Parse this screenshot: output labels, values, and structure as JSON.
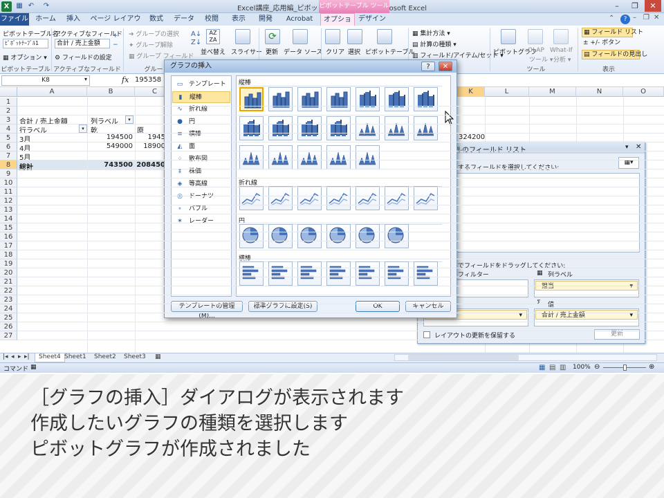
{
  "window": {
    "title": "Excel講座_応用編_ピボットテーブル.xlsx - Microsoft Excel",
    "qat_items": [
      "save-icon",
      "undo-icon",
      "redo-icon"
    ],
    "contextual_tab": "ピボットテーブル ツール"
  },
  "tabs": {
    "file": "ファイル",
    "home": "ホーム",
    "insert": "挿入",
    "page_layout": "ページ レイアウト",
    "formulas": "数式",
    "data": "データ",
    "review": "校閲",
    "view": "表示",
    "developer": "開発",
    "acrobat": "Acrobat",
    "options": "オプション",
    "design": "デザイン"
  },
  "ribbon": {
    "pivottable_name_label": "ピボットテーブル名:",
    "pivottable_name_value": "ﾋﾟﾎﾞｯﾄﾃｰﾌﾞﾙ1",
    "options_label": "オプション",
    "group_pivottable": "ピボットテーブル",
    "active_field_label": "アクティブなフィールド:",
    "active_field_value": "合計 / 売上金額",
    "field_settings": "フィールドの設定",
    "group_active_field": "アクティブなフィールド",
    "group_selection": "グループの選択",
    "ungroup": "グループ解除",
    "group_field": "グループ フィールド",
    "group_group": "グルー",
    "sort_label": "並べ替え",
    "slicer": "スライサー",
    "refresh": "更新",
    "data_source": "データ ソース",
    "clear": "クリア",
    "select": "選択",
    "move_pivottable": "ピボットテーブル",
    "summarize_by": "集計方法",
    "calc_type": "計算の種類",
    "fields_items_sets": "フィールド/アイテム/セット",
    "pivot_chart": "ピボットグラフ",
    "olap_tools": "OLAP",
    "olap_tools_2": "ツール",
    "what_if": "What-If",
    "what_if_2": "分析",
    "group_tools": "ツール",
    "field_list": "フィールド リスト",
    "buttons": "+/- ボタン",
    "field_headers": "フィールドの見出し",
    "group_show": "表示"
  },
  "formula_bar": {
    "name_box": "K8",
    "fx": "fx",
    "formula": "195358"
  },
  "columns": [
    "A",
    "B",
    "C",
    "K",
    "L",
    "M",
    "N",
    "O"
  ],
  "rows": [
    "1",
    "2",
    "3",
    "4",
    "5",
    "6",
    "7",
    "8",
    "9",
    "10",
    "11",
    "12",
    "13",
    "14",
    "15",
    "16",
    "17",
    "18",
    "19",
    "20",
    "21",
    "22",
    "23",
    "24",
    "25",
    "26",
    "27"
  ],
  "pivot": {
    "title": "合計 / 売上金額",
    "col_label": "列ラベル",
    "row_label": "行ラベル",
    "col_b_header": "乾",
    "col_c_header": "原",
    "rows": [
      {
        "label": "3月",
        "b": "194500",
        "c": "1945"
      },
      {
        "label": "4月",
        "b": "549000",
        "c": "18900"
      },
      {
        "label": "5月",
        "b": "",
        "c": ""
      }
    ],
    "total_label": "総計",
    "total_b": "743500",
    "total_c": "208450",
    "k_value": "324200"
  },
  "sheets": [
    "Sheet4",
    "Sheet1",
    "Sheet2",
    "Sheet3"
  ],
  "status": {
    "mode": "コマンド",
    "zoom": "100%"
  },
  "field_list": {
    "title": "ブルのフィールド リスト",
    "select_prompt": "するフィールドを選択してください:",
    "drag_prompt": "でフィールドをドラッグしてください:",
    "report_filter": "フィルター",
    "column_labels": "列ラベル",
    "column_value": "担当",
    "values": "値",
    "values_value": "合計 / 売上金額",
    "defer_update": "レイアウトの更新を保留する",
    "update_button": "更新"
  },
  "dialog": {
    "title": "グラフの挿入",
    "categories": [
      {
        "label": "テンプレート",
        "icon": "folder-icon"
      },
      {
        "label": "縦棒",
        "icon": "column-chart-icon"
      },
      {
        "label": "折れ線",
        "icon": "line-chart-icon"
      },
      {
        "label": "円",
        "icon": "pie-chart-icon"
      },
      {
        "label": "横棒",
        "icon": "bar-chart-icon"
      },
      {
        "label": "面",
        "icon": "area-chart-icon"
      },
      {
        "label": "散布図",
        "icon": "scatter-chart-icon"
      },
      {
        "label": "株価",
        "icon": "stock-chart-icon"
      },
      {
        "label": "等高線",
        "icon": "surface-chart-icon"
      },
      {
        "label": "ドーナツ",
        "icon": "doughnut-chart-icon"
      },
      {
        "label": "バブル",
        "icon": "bubble-chart-icon"
      },
      {
        "label": "レーダー",
        "icon": "radar-chart-icon"
      }
    ],
    "selected_category": "縦棒",
    "section_column": "縦棒",
    "section_line": "折れ線",
    "section_pie": "円",
    "section_bar": "横棒",
    "manage_templates": "テンプレートの管理(M)...",
    "set_default": "標準グラフに設定(S)",
    "ok": "OK",
    "cancel": "キャンセル"
  },
  "caption": {
    "line1": "［グラフの挿入］ダイアログが表示されます",
    "line2": "作成したいグラフの種類を選択します",
    "line3": "ピボットグラフが作成されました"
  }
}
